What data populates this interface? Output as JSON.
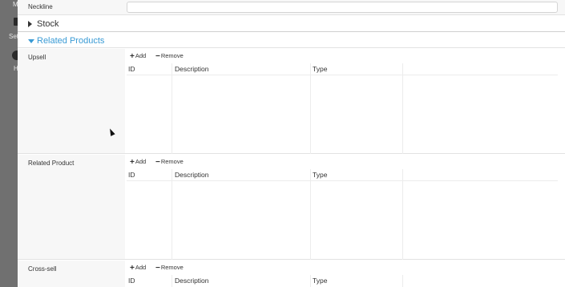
{
  "sidebar": {
    "texts": [
      "M",
      "Set",
      "H"
    ]
  },
  "fields": {
    "neckline_label": "Neckline",
    "neckline_value": ""
  },
  "sections": {
    "stock_title": "Stock",
    "related_title": "Related Products"
  },
  "toolbar": {
    "add_label": "Add",
    "remove_label": "Remove"
  },
  "table_columns": [
    "ID",
    "Description",
    "Type"
  ],
  "blocks": [
    {
      "label": "Upsell"
    },
    {
      "label": "Related Product"
    },
    {
      "label": "Cross-sell"
    }
  ]
}
